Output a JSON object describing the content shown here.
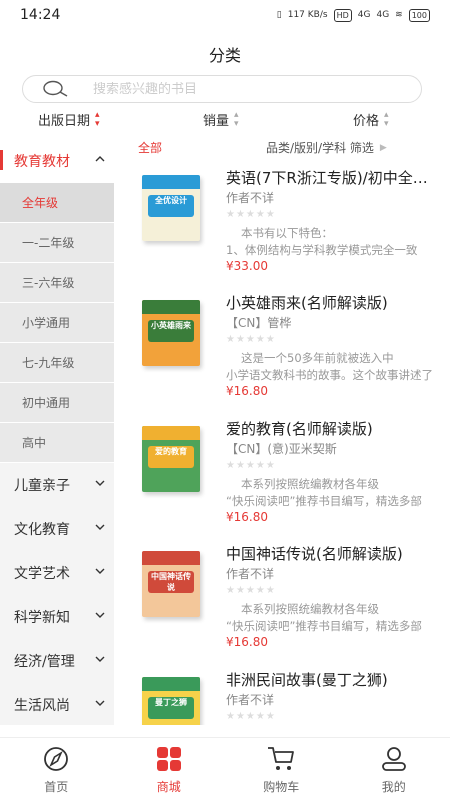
{
  "status_bar": {
    "time": "14:24",
    "net_speed": "117 KB/s",
    "hd": "HD",
    "sig1": "4G",
    "sig2": "4G",
    "battery": "100"
  },
  "page": {
    "title": "分类"
  },
  "search": {
    "placeholder": "搜索感兴趣的书目"
  },
  "sort": [
    {
      "label": "出版日期",
      "active": true
    },
    {
      "label": "销量",
      "active": false
    },
    {
      "label": "价格",
      "active": false
    }
  ],
  "sidebar": {
    "categories": [
      {
        "label": "教育教材",
        "active": true,
        "expanded": true
      },
      {
        "label": "儿童亲子"
      },
      {
        "label": "文化教育"
      },
      {
        "label": "文学艺术"
      },
      {
        "label": "科学新知"
      },
      {
        "label": "经济/管理"
      },
      {
        "label": "生活风尚"
      }
    ],
    "subcategories": [
      "全年级",
      "一-二年级",
      "三-六年级",
      "小学通用",
      "七-九年级",
      "初中通用",
      "高中"
    ]
  },
  "filter": {
    "all_label": "全部",
    "filter_label": "品类/版别/学科 筛选"
  },
  "books": [
    {
      "title": "英语(7下R浙江专版)/初中全优设计",
      "author": "作者不详",
      "desc1": "本书有以下特色：",
      "desc2": "1、体例结构与学科教学模式完全一致",
      "price": "¥33.00",
      "cover_text": "全优设计",
      "cover_color": "#f5f0d8",
      "cover_accent": "#2a9bd6"
    },
    {
      "title": "小英雄雨来(名师解读版)",
      "author": "【CN】管桦",
      "desc1": "这是一个50多年前就被选入中",
      "desc2": "小学语文教科书的故事。这个故事讲述了",
      "price": "¥16.80",
      "cover_text": "小英雄雨来",
      "cover_color": "#f2a23a",
      "cover_accent": "#3a7d3a"
    },
    {
      "title": "爱的教育(名师解读版)",
      "author": "【CN】(意)亚米契斯",
      "desc1": "本系列按照统编教材各年级",
      "desc2": "“快乐阅读吧”推荐书目编写，精选多部",
      "price": "¥16.80",
      "cover_text": "爱的教育",
      "cover_color": "#4fa35a",
      "cover_accent": "#f0b030"
    },
    {
      "title": "中国神话传说(名师解读版)",
      "author": "作者不详",
      "desc1": "本系列按照统编教材各年级",
      "desc2": "“快乐阅读吧”推荐书目编写，精选多部",
      "price": "¥16.80",
      "cover_text": "中国神话传说",
      "cover_color": "#f3c79a",
      "cover_accent": "#d04a3a"
    },
    {
      "title": "非洲民间故事(曼丁之狮)",
      "author": "作者不详",
      "desc1": "",
      "desc2": "",
      "price": "",
      "cover_text": "曼丁之狮",
      "cover_color": "#f6d24a",
      "cover_accent": "#3a9a5a"
    }
  ],
  "tabbar": [
    {
      "label": "首页",
      "icon": "compass-icon",
      "active": false
    },
    {
      "label": "商城",
      "icon": "grid-icon",
      "active": true
    },
    {
      "label": "购物车",
      "icon": "cart-icon",
      "active": false
    },
    {
      "label": "我的",
      "icon": "user-icon",
      "active": false
    }
  ],
  "colors": {
    "accent": "#e53935",
    "sidebar_bg": "#f4f4f4"
  }
}
